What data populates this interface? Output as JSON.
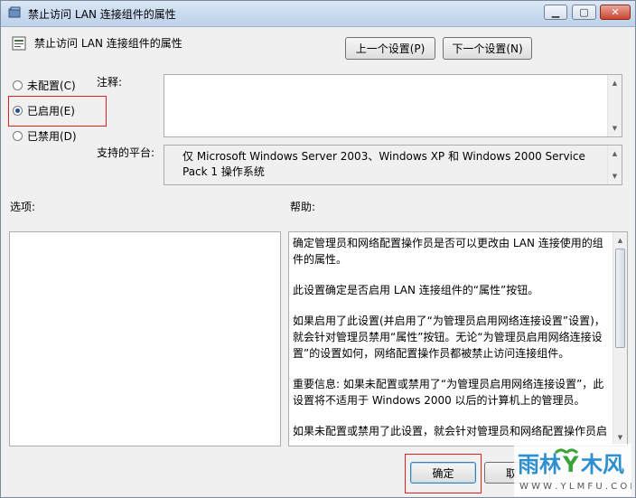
{
  "window": {
    "title": "禁止访问 LAN 连接组件的属性"
  },
  "header": {
    "title": "禁止访问 LAN 连接组件的属性",
    "prev_button": "上一个设置(P)",
    "next_button": "下一个设置(N)"
  },
  "radios": [
    {
      "label": "未配置(C)",
      "selected": false
    },
    {
      "label": "已启用(E)",
      "selected": true
    },
    {
      "label": "已禁用(D)",
      "selected": false
    }
  ],
  "comment_label": "注释:",
  "platform_label": "支持的平台:",
  "platform_value": "仅 Microsoft Windows Server 2003、Windows XP 和 Windows 2000 Service Pack 1 操作系统",
  "options_label": "选项:",
  "help_label": "帮助:",
  "help_paragraphs": [
    "确定管理员和网络配置操作员是否可以更改由 LAN 连接使用的组件的属性。",
    "此设置确定是否启用 LAN 连接组件的“属性”按钮。",
    "如果启用了此设置(并启用了“为管理员启用网络连接设置”设置)，就会针对管理员禁用“属性”按钮。无论“为管理员启用网络连接设置”的设置如何，网络配置操作员都被禁止访问连接组件。",
    "重要信息: 如果未配置或禁用了“为管理员启用网络连接设置”，此设置将不适用于 Windows 2000 以后的计算机上的管理员。",
    "如果未配置或禁用了此设置，就会针对管理员和网络配置操作员启"
  ],
  "footer": {
    "ok_button": "确定",
    "cancel_button": "取"
  },
  "watermark": {
    "text": "雨林木风",
    "url_text": "W W W . Y L M F U . C O M"
  }
}
